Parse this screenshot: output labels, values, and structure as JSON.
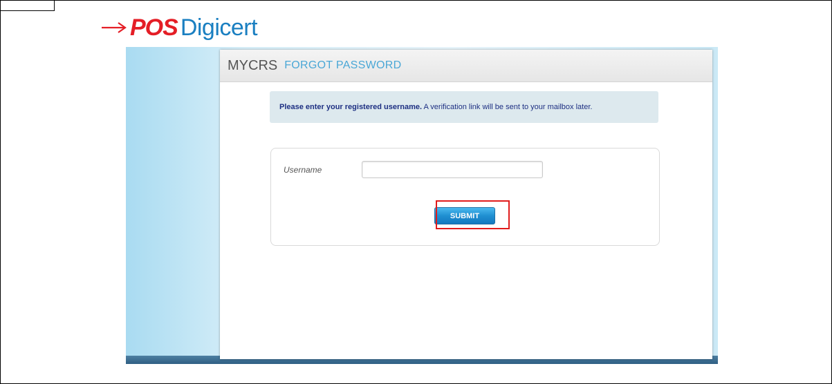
{
  "logo": {
    "pos_text": "POS",
    "digicert_text": "Digicert",
    "arrow_color": "#e41e26",
    "pos_color": "#e41e26",
    "digicert_color": "#1a7fc1"
  },
  "header": {
    "app_name": "MYCRS",
    "section_title": "FORGOT PASSWORD"
  },
  "info": {
    "message_bold": "Please enter your registered username.",
    "message_rest": " A verification link will be sent to your mailbox later."
  },
  "form": {
    "username_label": "Username",
    "username_value": "",
    "username_placeholder": "",
    "submit_label": "SUBMIT"
  },
  "colors": {
    "accent": "#4aa7d6",
    "button": "#1f8fd1",
    "highlight": "#e01b1b",
    "info_text": "#1d2f82"
  }
}
